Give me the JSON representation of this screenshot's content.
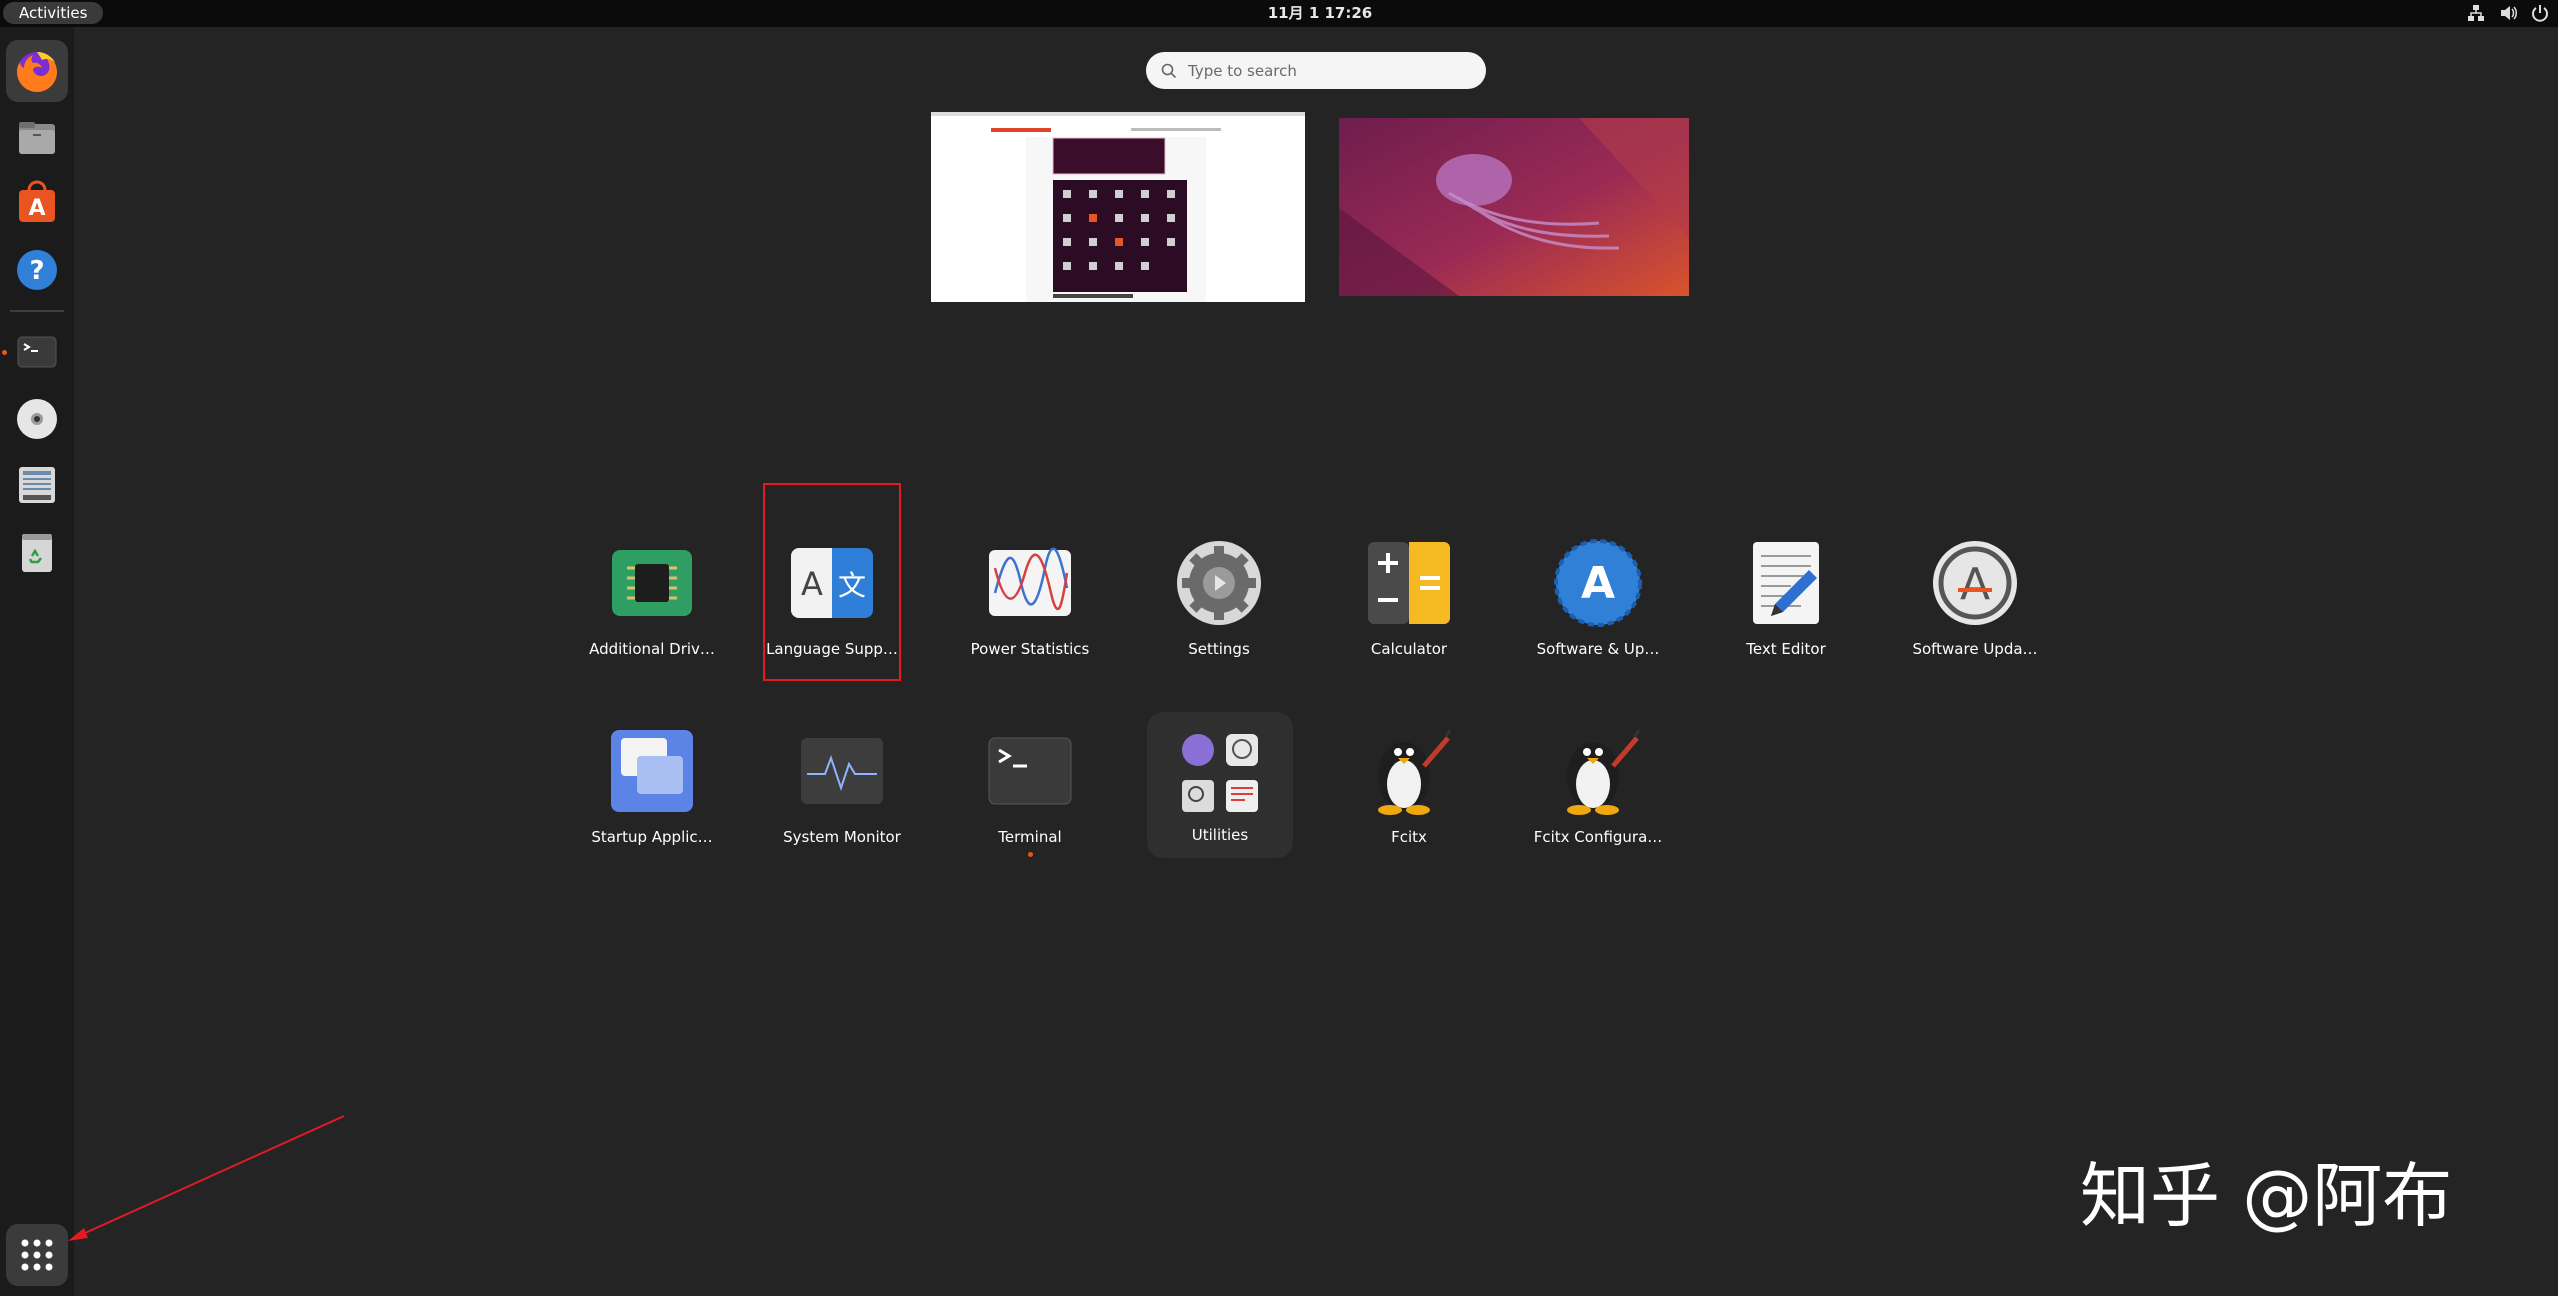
{
  "topbar": {
    "activities_label": "Activities",
    "clock": "11月 1  17:26",
    "tray_icons": [
      "network-icon",
      "volume-icon",
      "power-icon"
    ]
  },
  "dash": {
    "items": [
      {
        "name": "firefox-icon",
        "running": false,
        "active": true
      },
      {
        "name": "files-icon",
        "running": false
      },
      {
        "name": "app-center-icon",
        "running": false
      },
      {
        "name": "help-icon",
        "running": false
      },
      {
        "name": "terminal-icon",
        "running": true
      },
      {
        "name": "disc-icon",
        "running": false
      },
      {
        "name": "floppy-drive-icon",
        "running": false
      },
      {
        "name": "trash-icon",
        "running": false
      }
    ],
    "show_apps_icon": "grid-icon"
  },
  "search": {
    "placeholder": "Type to search"
  },
  "apps": {
    "row1": [
      {
        "label": "Additional Driv…",
        "icon": "chip-icon"
      },
      {
        "label": "Language Supp…",
        "icon": "language-icon",
        "highlighted": true
      },
      {
        "label": "Power Statistics",
        "icon": "power-statistics-icon"
      },
      {
        "label": "Settings",
        "icon": "settings-gear-icon"
      },
      {
        "label": "Calculator",
        "icon": "calculator-icon"
      },
      {
        "label": "Software & Up…",
        "icon": "software-updates-icon"
      },
      {
        "label": "Text Editor",
        "icon": "text-editor-icon"
      },
      {
        "label": "Software Upda…",
        "icon": "software-updater-icon"
      }
    ],
    "row2": [
      {
        "label": "Startup Applic…",
        "icon": "startup-apps-icon"
      },
      {
        "label": "System Monitor",
        "icon": "system-monitor-icon"
      },
      {
        "label": "Terminal",
        "icon": "terminal-icon",
        "running": true
      },
      {
        "label": "Utilities",
        "icon": "folder-icon",
        "is_folder": true
      },
      {
        "label": "Fcitx",
        "icon": "penguin-icon"
      },
      {
        "label": "Fcitx Configura…",
        "icon": "penguin-icon"
      }
    ]
  },
  "watermark": "知乎 @阿布",
  "colors": {
    "accent": "#e95420",
    "background": "#242424",
    "topbar": "#0b0b0b",
    "dash": "#1b1b1b",
    "highlight": "#e01b24"
  }
}
